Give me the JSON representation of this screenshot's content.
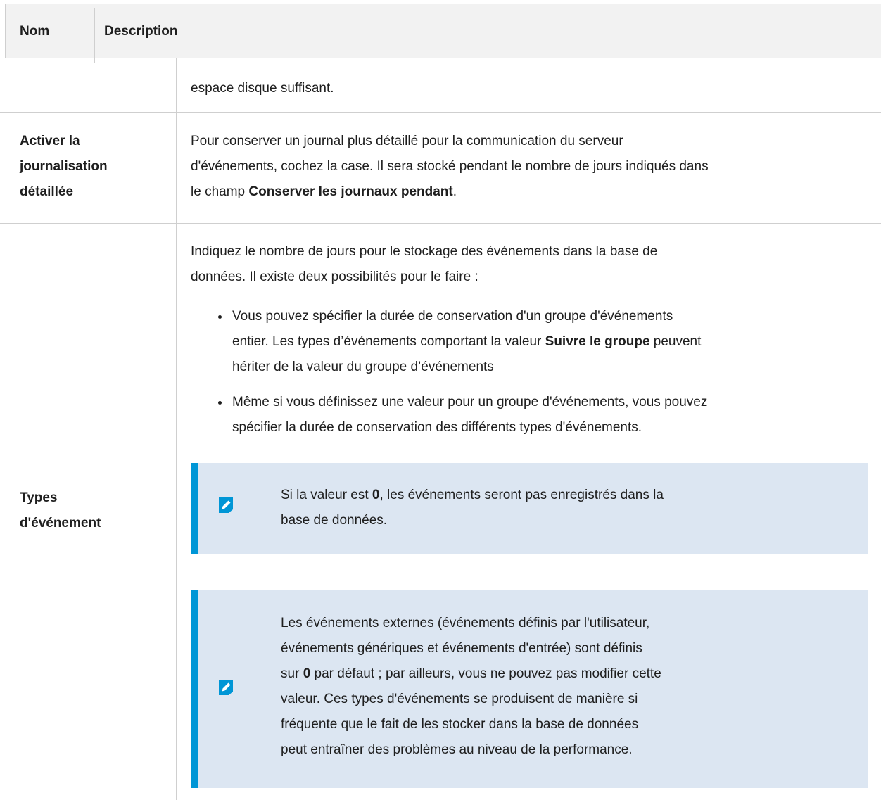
{
  "header": {
    "col_name": "Nom",
    "col_description": "Description"
  },
  "rows": [
    {
      "name": "",
      "description": "espace disque suffisant."
    },
    {
      "name_lines": [
        "Activer la",
        "journalisation",
        "détaillée"
      ],
      "desc_line1": "Pour conserver un journal plus détaillé pour la communication du serveur",
      "desc_line2": "d'événements, cochez la case. Il sera stocké pendant le nombre de jours indiqués dans",
      "desc_line3_pre": "le champ ",
      "desc_line3_bold": "Conserver les journaux pendant",
      "desc_line3_post": "."
    },
    {
      "name_lines": [
        "Types",
        "d'événement"
      ],
      "intro_line1": "Indiquez le nombre de jours pour le stockage des événements dans la base de",
      "intro_line2": "données. Il existe deux possibilités pour le faire :",
      "bullet1_line1": "Vous pouvez spécifier la durée de conservation d'un groupe d'événements",
      "bullet1_line2_pre": "entier. Les types d’événements comportant la valeur ",
      "bullet1_line2_bold": "Suivre le groupe",
      "bullet1_line2_post": " peuvent",
      "bullet1_line3": "hériter de la valeur du groupe d’événements",
      "bullet2_line1": "Même si vous définissez une valeur pour un groupe d'événements, vous pouvez",
      "bullet2_line2": "spécifier la durée de conservation des différents types d'événements.",
      "note1_line1_pre": "Si la valeur est ",
      "note1_line1_bold": "0",
      "note1_line1_post": ", les événements seront pas enregistrés dans la",
      "note1_line2": "base de données.",
      "note2_line1": "Les événements externes (événements définis par l'utilisateur,",
      "note2_line2": "événements génériques et événements d'entrée) sont définis",
      "note2_line3_pre": "sur ",
      "note2_line3_bold": "0",
      "note2_line3_post": " par défaut ; par ailleurs, vous ne pouvez pas modifier cette",
      "note2_line4": "valeur. Ces types d'événements se produisent de manière si",
      "note2_line5": "fréquente que le fait de les stocker dans la base de données",
      "note2_line6": "peut entraîner des problèmes au niveau de la performance."
    }
  ],
  "icons": {
    "note_icon": "pencil-note-icon"
  },
  "colors": {
    "header_bg": "#f2f2f2",
    "note_bg": "#dce6f2",
    "note_accent": "#0096d6",
    "grid": "#cfcfcf"
  }
}
